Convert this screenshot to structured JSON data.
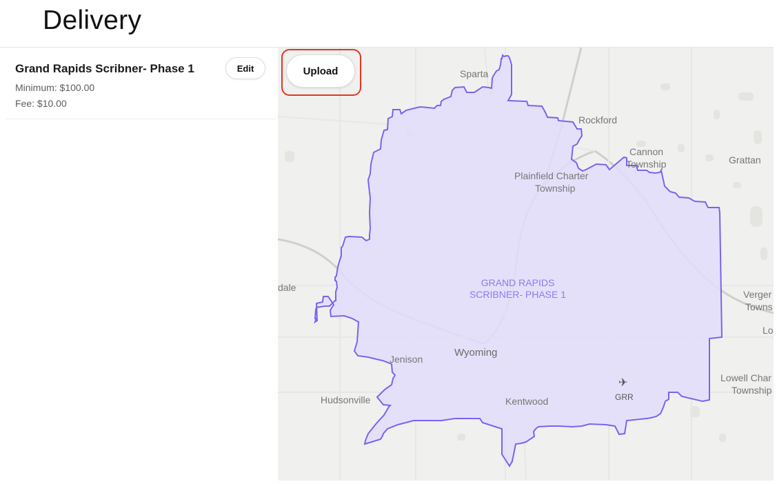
{
  "page": {
    "title": "Delivery"
  },
  "zones": [
    {
      "name": "Grand Rapids Scribner- Phase 1",
      "minimum": "Minimum: $100.00",
      "fee": "Fee: $10.00",
      "edit_label": "Edit"
    }
  ],
  "map": {
    "upload_label": "Upload",
    "zone_label_line1": "GRAND RAPIDS",
    "zone_label_line2": "SCRIBNER- PHASE 1",
    "places": {
      "sparta": "Sparta",
      "rockford": "Rockford",
      "cannon_1": "Cannon",
      "cannon_2": "Township",
      "grattan": "Grattan",
      "plainfield_1": "Plainfield Charter",
      "plainfield_2": "Township",
      "dale": "dale",
      "verge_1": "Verger",
      "verge_2": "Towns",
      "lo": "Lo",
      "jenison": "Jenison",
      "wyoming": "Wyoming",
      "lowell_1": "Lowell Char",
      "lowell_2": "Township",
      "hudsonville": "Hudsonville",
      "kentwood": "Kentwood",
      "airport": "GRR"
    },
    "colors": {
      "zone_fill": "#e3ddfb",
      "zone_stroke": "#7a63f2",
      "highlight": "#e4341f"
    },
    "icons": {
      "airport": "airplane-icon"
    }
  }
}
